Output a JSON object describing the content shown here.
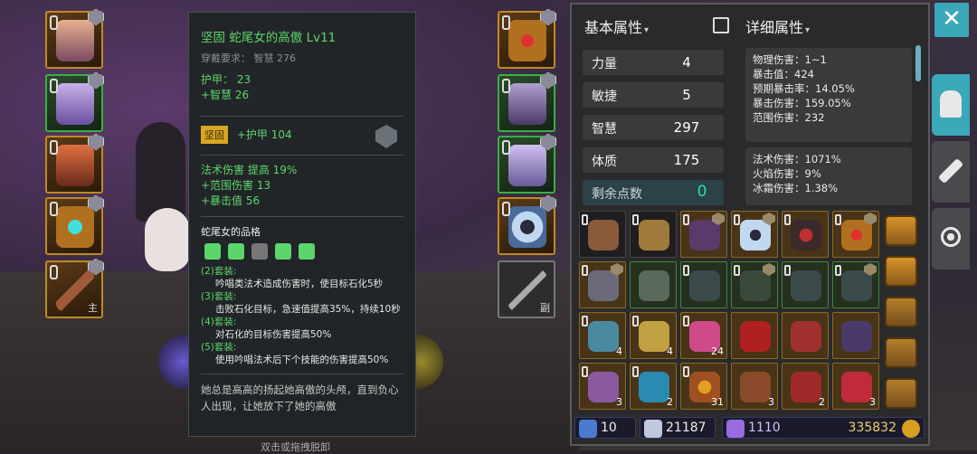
{
  "tooltip": {
    "title": "坚固 蛇尾女的高傲 Lv11",
    "requirement": "穿戴要求： 智慧 276",
    "base_stats": [
      "护甲： 23",
      "+智慧 26"
    ],
    "enchant_tag": "坚固",
    "enchant_value": "+护甲 104",
    "bonus_stats": [
      "法术伤害 提高 19%",
      "+范围伤害 13",
      "+暴击值 56"
    ],
    "set_title": "蛇尾女的品格",
    "sets": [
      {
        "head": "(2)套装:",
        "desc": "吟唱类法术造成伤害时，使目标石化5秒"
      },
      {
        "head": "(3)套装:",
        "desc": "击败石化目标，急速值提高35%，持续10秒"
      },
      {
        "head": "(4)套装:",
        "desc": "对石化的目标伤害提高50%"
      },
      {
        "head": "(5)套装:",
        "desc": "使用吟唱法术后下个技能的伤害提高50%"
      }
    ],
    "description": "她总是高高的扬起她高傲的头颅，直到负心人出现，让她放下了她的高傲",
    "bottom_hint": "双击或拖拽脱卸"
  },
  "equip_left_sub": "主",
  "equip_right_sub": "副",
  "basic": {
    "header": "基本属性",
    "caret": "▾",
    "stats": [
      {
        "label": "力量",
        "value": "4"
      },
      {
        "label": "敏捷",
        "value": "5"
      },
      {
        "label": "智慧",
        "value": "297"
      },
      {
        "label": "体质",
        "value": "175"
      }
    ],
    "remaining_label": "剩余点数",
    "remaining_value": "0"
  },
  "detail": {
    "header": "详细属性",
    "caret": "▾",
    "box1": [
      "物理伤害：1~1",
      "暴击值：424",
      "预期暴击率：14.05%",
      "暴击伤害：159.05%",
      "范围伤害：232"
    ],
    "box2": [
      "法术伤害：1071%",
      "火焰伤害：9%",
      "冰霜伤害：1.38%"
    ]
  },
  "inventory_counts": {
    "r3c1": "4",
    "r3c2": "4",
    "r3c3": "24",
    "r4c1": "3",
    "r4c2": "2",
    "r4c3": "31",
    "r4c5": "3",
    "r4c6": "2",
    "r4c7": "3"
  },
  "currency": {
    "pvp": "10",
    "honor": "21187",
    "crystal": "1110",
    "gold": "335832"
  },
  "close_label": "✕",
  "colors": {
    "accent": "#3aa8b8",
    "green_text": "#5cd66a",
    "gold_border": "#c08a20"
  }
}
